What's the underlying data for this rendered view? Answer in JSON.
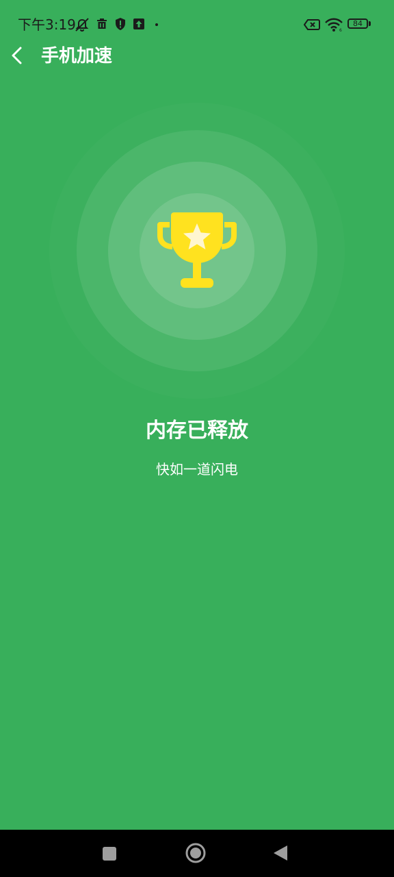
{
  "status_bar": {
    "time": "下午3:19",
    "battery_level": "84",
    "left_icons": [
      "bell-off-icon",
      "trash-icon",
      "shield-icon",
      "upload-icon",
      "dot-icon"
    ],
    "right_icons": [
      "sim-error-icon",
      "wifi-icon",
      "battery-icon"
    ]
  },
  "header": {
    "back_icon": "chevron-left-icon",
    "title": "手机加速"
  },
  "result": {
    "icon": "trophy-icon",
    "title": "内存已释放",
    "subtitle": "快如一道闪电"
  },
  "nav_bar": {
    "buttons": [
      "recent-apps",
      "home",
      "back"
    ]
  },
  "colors": {
    "background": "#38AF5B",
    "trophy": "#FFE21F",
    "text": "#FFFFFF",
    "nav_bar": "#000000"
  }
}
